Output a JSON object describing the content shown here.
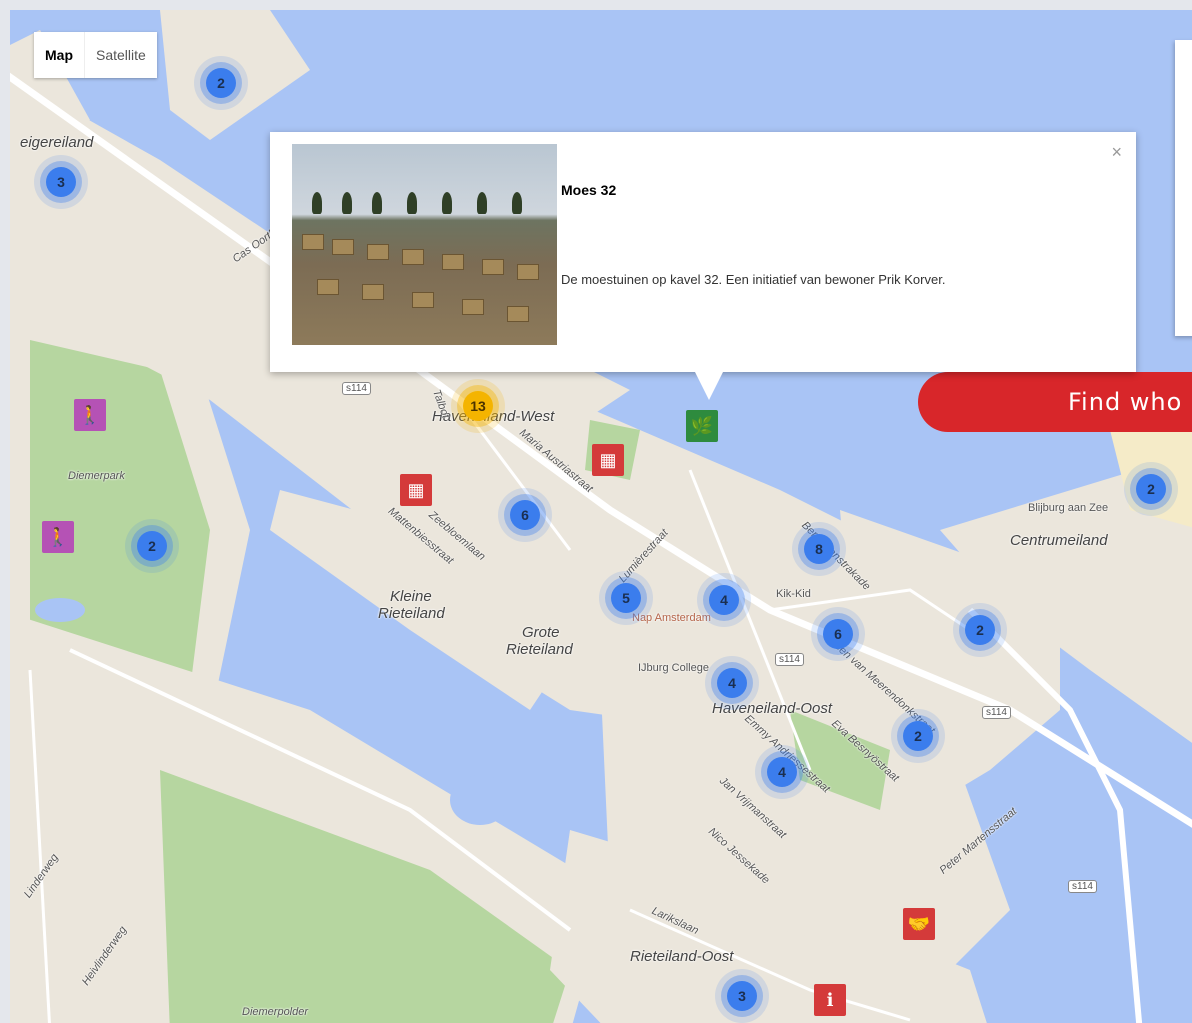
{
  "map_type": {
    "map_label": "Map",
    "satellite_label": "Satellite"
  },
  "infowindow": {
    "title": "Moes 32",
    "description": "De moestuinen op kavel 32. Een initiatief van bewoner Prik Korver.",
    "close": "×"
  },
  "find_button": "Find who",
  "labels": {
    "haveneiland_west": "Haveneiland-West",
    "diemerpark": "Diemerpark",
    "kleine_rieteiland_1": "Kleine",
    "kleine_rieteiland_2": "Rieteiland",
    "grote_rieteiland_1": "Grote",
    "grote_rieteiland_2": "Rieteiland",
    "haveneiland_oost": "Haveneiland-Oost",
    "rieteiland_oost": "Rieteiland-Oost",
    "centrumeiland": "Centrumeiland",
    "blijburg": "Blijburg aan Zee",
    "diemerpolder": "Diemerpolder",
    "steigereiland": "eigereiland",
    "kik_kid": "Kik-Kid",
    "nap_amsterdam": "Nap Amsterdam",
    "ijburg_college": "IJburg College",
    "maria_austria": "Maria Austriastraat",
    "mattenbies": "Mattenbiesstraat",
    "zeebloemlaan": "Zeebloemlaan",
    "lumiere": "Lumièrestraat",
    "ben_van_meerendonk": "Ben van Meerendonkstraat",
    "eva_besnyo": "Eva Besnyöstraat",
    "jan_vrijman": "Jan Vrijmanstraat",
    "nico_jessekade": "Nico Jessekade",
    "peter_martens": "Peter Martensstraat",
    "larikslaan": "Larikslaan",
    "emmy_andriesse": "Emmy Andriessestraat",
    "berthaanstrakade": "Bert Haanstrakade",
    "heivlinderweg": "Heivlinderweg",
    "zuiderweg": "Linderweg",
    "cas_oorthuys": "Cas Oorthuys",
    "talbot": "Talbot",
    "s114a": "s114",
    "s114b": "s114",
    "s114c": "s114",
    "s114d": "s114",
    "s114e": "s114"
  },
  "clusters": [
    "2",
    "3",
    "13",
    "6",
    "2",
    "5",
    "4",
    "8",
    "6",
    "2",
    "4",
    "2",
    "4",
    "3",
    "2"
  ],
  "colors": {
    "water": "#a9c4f5",
    "land": "#ebe6dc",
    "park": "#b6d6a0",
    "cluster_blue": "#3b7ded",
    "cluster_yellow": "#f4b400",
    "button_red": "#d8262a"
  }
}
